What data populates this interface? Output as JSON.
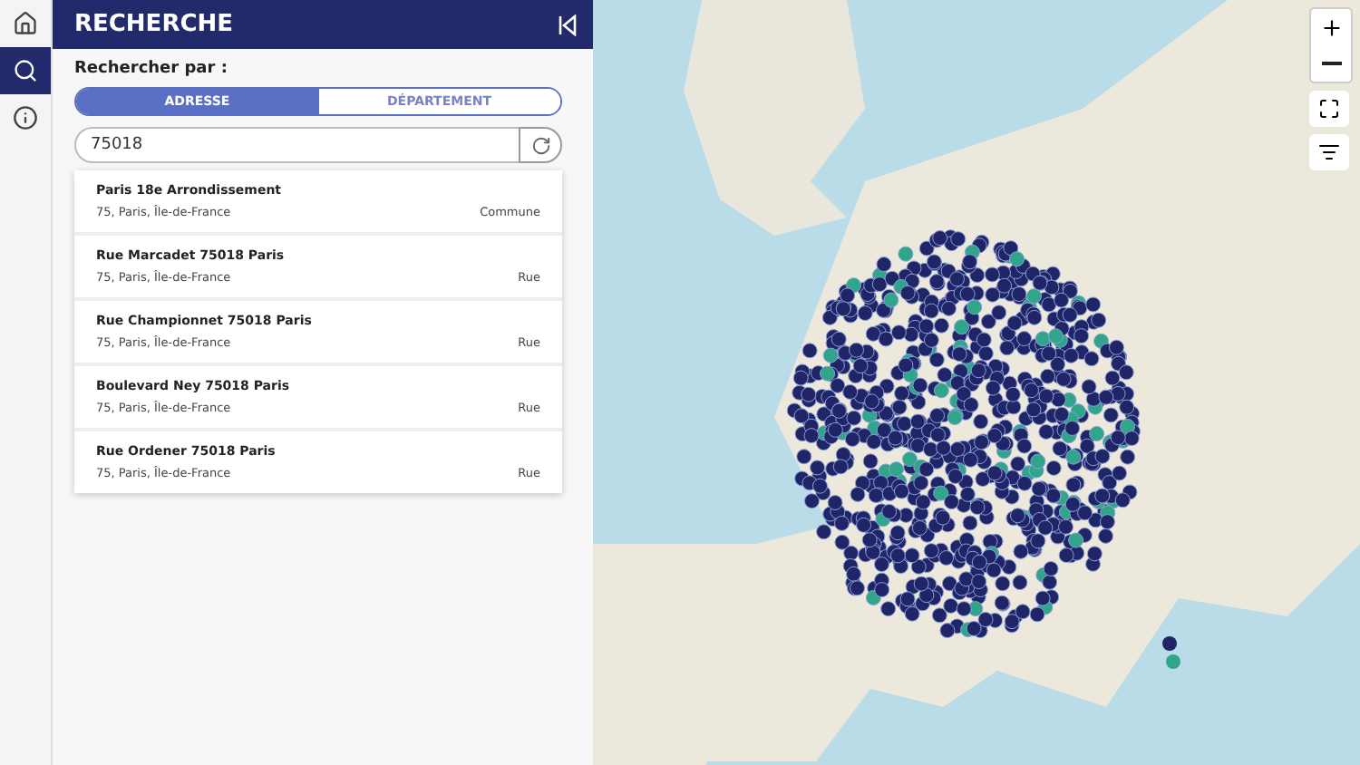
{
  "nav": [
    {
      "kind": "home",
      "selected": false
    },
    {
      "kind": "search",
      "selected": true
    },
    {
      "kind": "info",
      "selected": false
    }
  ],
  "panel": {
    "title": "RECHERCHE",
    "search_by_label": "Rechercher par :",
    "modes": [
      {
        "label": "ADRESSE",
        "selected": true
      },
      {
        "label": "DÉPARTEMENT",
        "selected": false
      }
    ],
    "query": "75018",
    "results": [
      {
        "name": "Paris 18e Arrondissement",
        "location": "75, Paris, Île-de-France",
        "type": "Commune"
      },
      {
        "name": "Rue Marcadet 75018 Paris",
        "location": "75, Paris, Île-de-France",
        "type": "Rue"
      },
      {
        "name": "Rue Championnet 75018 Paris",
        "location": "75, Paris, Île-de-France",
        "type": "Rue"
      },
      {
        "name": "Boulevard Ney 75018 Paris",
        "location": "75, Paris, Île-de-France",
        "type": "Rue"
      },
      {
        "name": "Rue Ordener 75018 Paris",
        "location": "75, Paris, Île-de-France",
        "type": "Rue"
      }
    ]
  }
}
